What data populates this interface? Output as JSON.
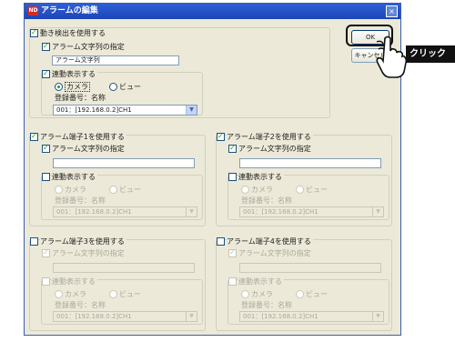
{
  "window": {
    "title_icon": "ND",
    "title": "アラームの編集",
    "close_glyph": "×"
  },
  "buttons": {
    "ok": "OK",
    "cancel": "キャンセル"
  },
  "callout": {
    "label": "クリック"
  },
  "motion": {
    "enable_label": "動き検出を使用する",
    "text_spec_label": "アラーム文字列の指定",
    "text_value": "アラーム文字列",
    "linked_label": "連動表示する",
    "radio_camera": "カメラ",
    "radio_view": "ビュー",
    "reg_label": "登録番号：名称",
    "select_value": "001：[192.168.0.2]CH1"
  },
  "terminals": [
    {
      "enable_label": "アラーム端子1を使用する",
      "text_spec_label": "アラーム文字列の指定",
      "text_value": "",
      "linked_label": "連動表示する",
      "radio_camera": "カメラ",
      "radio_view": "ビュー",
      "reg_label": "登録番号：名称",
      "select_value": "001：[192.168.0.2]CH1"
    },
    {
      "enable_label": "アラーム端子2を使用する",
      "text_spec_label": "アラーム文字列の指定",
      "text_value": "",
      "linked_label": "連動表示する",
      "radio_camera": "カメラ",
      "radio_view": "ビュー",
      "reg_label": "登録番号：名称",
      "select_value": "001：[192.168.0.2]CH1"
    },
    {
      "enable_label": "アラーム端子3を使用する",
      "text_spec_label": "アラーム文字列の指定",
      "text_value": "",
      "linked_label": "連動表示する",
      "radio_camera": "カメラ",
      "radio_view": "ビュー",
      "reg_label": "登録番号：名称",
      "select_value": "001：[192.168.0.2]CH1"
    },
    {
      "enable_label": "アラーム端子4を使用する",
      "text_spec_label": "アラーム文字列の指定",
      "text_value": "",
      "linked_label": "連動表示する",
      "radio_camera": "カメラ",
      "radio_view": "ビュー",
      "reg_label": "登録番号：名称",
      "select_value": "001：[192.168.0.2]CH1"
    }
  ],
  "colors": {
    "titlebar": "#1c46b6",
    "dialog_bg": "#ece9d8",
    "check_green": "#21a121"
  }
}
